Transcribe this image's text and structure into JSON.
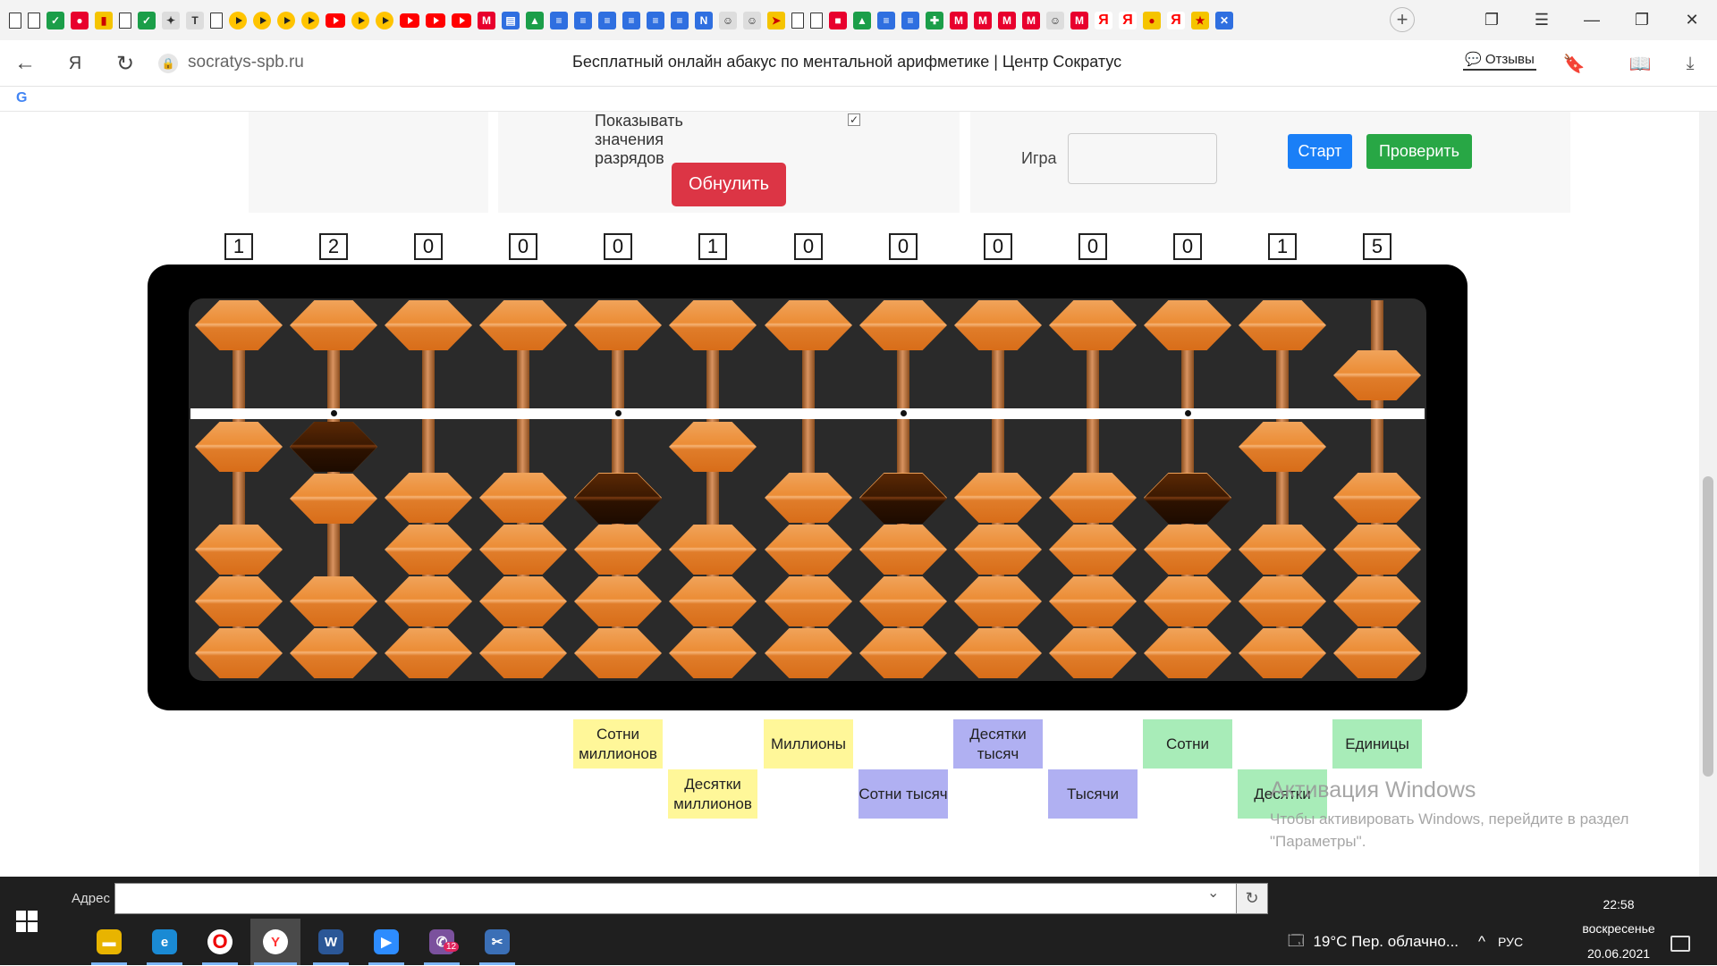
{
  "browser": {
    "bookmarks": [
      "doc",
      "doc",
      "check",
      "ball",
      "chart",
      "doc",
      "check",
      "puzzle",
      "T",
      "doc",
      "play",
      "play",
      "play",
      "play",
      "yt",
      "play",
      "play",
      "yt",
      "yt",
      "yt",
      "m",
      "book",
      "drive",
      "blue",
      "blue",
      "blue",
      "blue",
      "blue",
      "blue",
      "N",
      "person",
      "person",
      "send",
      "doc",
      "doc",
      "red",
      "drive",
      "blue",
      "blue",
      "plus",
      "m",
      "m",
      "m",
      "m",
      "person",
      "m",
      "ya",
      "ya",
      "cat",
      "ya",
      "star",
      "x"
    ],
    "new_tab_icon": "+",
    "domain": "socratys-spb.ru",
    "page_title": "Бесплатный онлайн абакус по ментальной арифметике | Центр Сократус",
    "reviews_label": "Отзывы",
    "google_icon": "G"
  },
  "page": {
    "show_values_label": "Показывать значения разрядов",
    "show_values_checked": true,
    "reset_label": "Обнулить",
    "game_label": "Игра",
    "game_value": "",
    "start_label": "Старт",
    "check_label": "Проверить"
  },
  "abacus": {
    "digits": [
      "1",
      "2",
      "0",
      "0",
      "0",
      "1",
      "0",
      "0",
      "0",
      "0",
      "0",
      "1",
      "5"
    ],
    "upper_active": [
      false,
      false,
      false,
      false,
      false,
      false,
      false,
      false,
      false,
      false,
      false,
      false,
      true
    ],
    "lower_count": [
      1,
      2,
      0,
      0,
      0,
      1,
      0,
      0,
      0,
      0,
      0,
      1,
      0
    ],
    "colors": {
      "bead": "#ec8d36",
      "dark_bead": "#3d1a02",
      "frame": "#000000",
      "inner": "#2a2a2a"
    }
  },
  "place_labels": [
    {
      "text": "Сотни миллионов",
      "color": "yellow",
      "column": 4,
      "row": 1
    },
    {
      "text": "Десятки миллионов",
      "color": "yellow",
      "column": 5,
      "row": 2
    },
    {
      "text": "Миллионы",
      "color": "yellow",
      "column": 6,
      "row": 1
    },
    {
      "text": "Сотни тысяч",
      "color": "blue",
      "column": 7,
      "row": 2
    },
    {
      "text": "Десятки тысяч",
      "color": "blue",
      "column": 8,
      "row": 1
    },
    {
      "text": "Тысячи",
      "color": "blue",
      "column": 9,
      "row": 2
    },
    {
      "text": "Сотни",
      "color": "green",
      "column": 10,
      "row": 1
    },
    {
      "text": "Десятки",
      "color": "green",
      "column": 11,
      "row": 2
    },
    {
      "text": "Единицы",
      "color": "green",
      "column": 12,
      "row": 1
    }
  ],
  "watermark": {
    "title": "Активация Windows",
    "subtitle": "Чтобы активировать Windows, перейдите в раздел \"Параметры\"."
  },
  "taskbar": {
    "address_label": "Адрес",
    "address_value": "",
    "apps": [
      "explorer",
      "edge",
      "opera",
      "yandex",
      "word",
      "zoom",
      "viber",
      "snip"
    ],
    "viber_badge": "12",
    "weather": "19°C  Пер. облачно...",
    "lang": "РУС",
    "time": "22:58",
    "day": "воскресенье",
    "date": "20.06.2021"
  }
}
